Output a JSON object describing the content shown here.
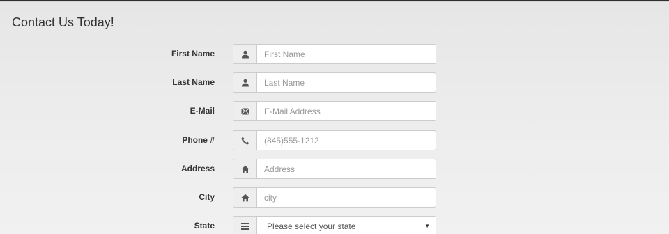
{
  "form": {
    "title": "Contact Us Today!",
    "fields": [
      {
        "label": "First Name",
        "placeholder": "First Name",
        "icon": "user-icon"
      },
      {
        "label": "Last Name",
        "placeholder": "Last Name",
        "icon": "user-icon"
      },
      {
        "label": "E-Mail",
        "placeholder": "E-Mail Address",
        "icon": "envelope-icon"
      },
      {
        "label": "Phone #",
        "placeholder": "(845)555-1212",
        "icon": "phone-icon"
      },
      {
        "label": "Address",
        "placeholder": "Address",
        "icon": "home-icon"
      },
      {
        "label": "City",
        "placeholder": "city",
        "icon": "home-icon"
      }
    ],
    "state": {
      "label": "State",
      "selected": "Please select your state",
      "icon": "list-icon"
    }
  },
  "colors": {
    "background_top": "#e6e6e6",
    "background_bottom": "#f1f1f1",
    "addon_bg": "#eeeeee",
    "border": "#cccccc",
    "label_text": "#333333",
    "placeholder": "#999999"
  }
}
